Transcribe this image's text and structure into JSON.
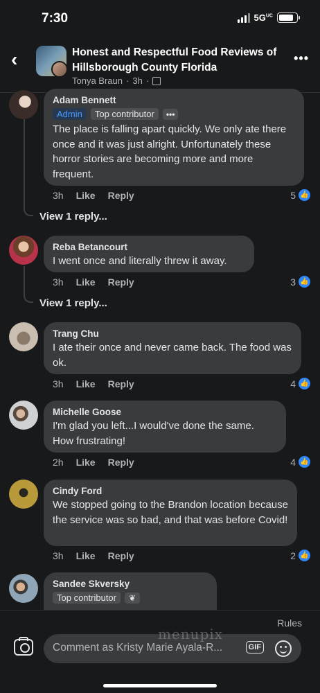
{
  "status": {
    "time": "7:30",
    "network": "5G",
    "network_suffix": "UC"
  },
  "header": {
    "title": "Honest and Respectful Food Reviews of Hillsborough County Florida",
    "author": "Tonya Braun",
    "age": "3h"
  },
  "comments": [
    {
      "name": "Adam Bennett",
      "badges": [
        "Admin",
        "Top contributor",
        "•••"
      ],
      "text": "The place is falling apart quickly. We only ate there once and it was just alright. Unfortunately these horror stories are becoming more and more frequent.",
      "age": "3h",
      "like": "Like",
      "reply": "Reply",
      "likes": "5",
      "view_replies": "View 1 reply..."
    },
    {
      "name": "Reba Betancourt",
      "text": "I went once and literally threw it away.",
      "age": "3h",
      "like": "Like",
      "reply": "Reply",
      "likes": "3",
      "view_replies": "View 1 reply..."
    },
    {
      "name": "Trang Chu",
      "text": "I ate their once and never came back. The food was ok.",
      "age": "3h",
      "like": "Like",
      "reply": "Reply",
      "likes": "4"
    },
    {
      "name": "Michelle Goose",
      "text": "I'm glad you left...I would've done the same. How frustrating!",
      "age": "2h",
      "like": "Like",
      "reply": "Reply",
      "likes": "4"
    },
    {
      "name": "Cindy Ford",
      "text": "We stopped going to the Brandon location because the service was so bad, and that was before Covid!",
      "age": "3h",
      "like": "Like",
      "reply": "Reply",
      "likes": "2"
    },
    {
      "name": "Sandee Skversky",
      "badges": [
        "Top contributor"
      ]
    }
  ],
  "footer": {
    "rules": "Rules",
    "comment_placeholder": "Comment as Kristy Marie Ayala-R...",
    "gif_label": "GIF",
    "watermark": "menupix"
  },
  "colors": {
    "background": "#18191a",
    "bubble": "#3a3b3c",
    "accent": "#2d88ff",
    "admin_text": "#4599ff"
  },
  "icons": [
    "back-arrow-icon",
    "more-icon",
    "group-privacy-icon",
    "like-icon",
    "camera-icon",
    "gif-icon",
    "emoji-icon",
    "sprout-icon"
  ]
}
